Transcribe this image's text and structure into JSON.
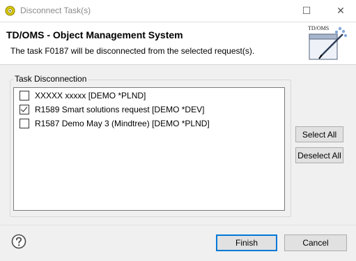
{
  "window": {
    "title": "Disconnect Task(s)",
    "minimize_glyph": "☐",
    "close_glyph": "✕"
  },
  "banner": {
    "title": "TD/OMS - Object Management System",
    "message": "The task F0187 will be disconnected from the selected request(s).",
    "image_text": "TD/OMS"
  },
  "group": {
    "label": "Task Disconnection"
  },
  "requests": [
    {
      "label": "XXXXX xxxxx [DEMO *PLND]",
      "checked": false
    },
    {
      "label": "R1589 Smart solutions request [DEMO *DEV]",
      "checked": true
    },
    {
      "label": "R1587 Demo May 3 (Mindtree) [DEMO *PLND]",
      "checked": false
    }
  ],
  "buttons": {
    "select_all": "Select All",
    "deselect_all": "Deselect All",
    "finish": "Finish",
    "cancel": "Cancel"
  },
  "colors": {
    "accent": "#0078d7",
    "app_icon": "#c8b400"
  },
  "icons": {
    "app": "tdoms-app-icon",
    "help": "help-icon"
  }
}
